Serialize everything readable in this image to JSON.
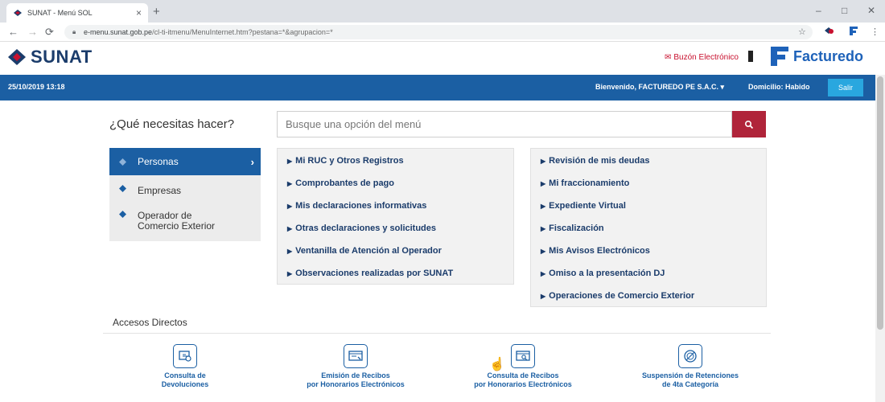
{
  "browser": {
    "tab_title": "SUNAT - Menú SOL",
    "tab_close": "×",
    "new_tab": "+",
    "url_host": "e-menu.sunat.gob.pe",
    "url_path": "/cl-ti-itmenu/MenuInternet.htm?pestana=*&agrupacion=*",
    "window_controls": [
      "–",
      "□",
      "✕"
    ]
  },
  "header": {
    "brand": "SUNAT",
    "buzon_label": "Buzón Electrónico",
    "partner_brand": "Facturedo"
  },
  "userbar": {
    "datetime": "25/10/2019 13:18",
    "welcome": "Bienvenido, FACTUREDO PE S.A.C. ▾",
    "domicilio": "Domicilio: Habido",
    "salir": "Salir"
  },
  "search": {
    "question": "¿Qué necesitas hacer?",
    "placeholder": "Busque una opción del menú"
  },
  "left_menu": {
    "items": [
      {
        "label": "Personas"
      },
      {
        "label": "Empresas"
      },
      {
        "label1": "Operador de",
        "label2": "Comercio Exterior"
      }
    ],
    "chevron": "›"
  },
  "options_col1": [
    "Mi RUC y Otros Registros",
    "Comprobantes de pago",
    "Mis declaraciones informativas",
    "Otras declaraciones y solicitudes",
    "Ventanilla de Atención al Operador",
    "Observaciones realizadas por SUNAT"
  ],
  "options_col2": [
    "Revisión de mis deudas",
    "Mi fraccionamiento",
    "Expediente Virtual",
    "Fiscalización",
    "Mis Avisos Electrónicos",
    "Omiso a la presentación DJ",
    "Operaciones de Comercio Exterior"
  ],
  "accesos": {
    "title": "Accesos Directos",
    "items": [
      {
        "line1": "Consulta de",
        "line2": "Devoluciones"
      },
      {
        "line1": "Emisión de Recibos",
        "line2": "por Honorarios Electrónicos"
      },
      {
        "line1": "Consulta de Recibos",
        "line2": "por Honorarios Electrónicos"
      },
      {
        "line1": "Suspensión de Retenciones",
        "line2": "de 4ta Categoría"
      }
    ]
  },
  "colors": {
    "sunat_blue": "#1b5fa3",
    "search_red": "#b0243a",
    "salir_cyan": "#29a7df"
  }
}
